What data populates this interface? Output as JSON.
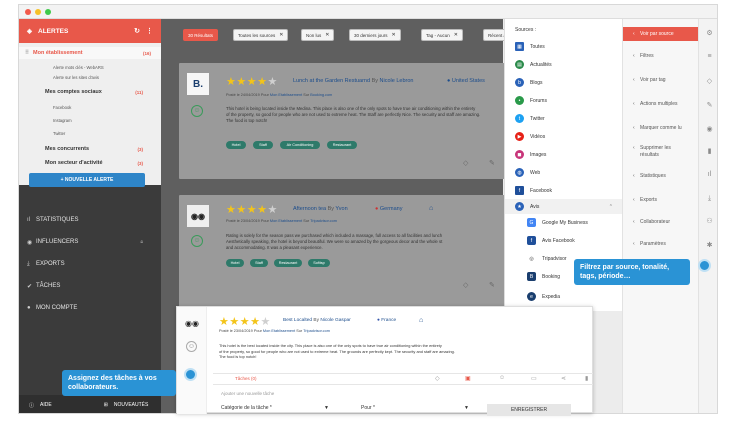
{
  "window": {
    "dots": [
      "#f25a4a",
      "#f6c128",
      "#3fc94a"
    ]
  },
  "sidebar": {
    "alerts_title": "ALERTES",
    "alerts_icon": "tag-icon",
    "panel": {
      "etablissement": "Mon établissement",
      "etablissement_count": "(16)",
      "sub1": "Alerte mots clés - WebARS",
      "sub2": "Alerte sur les sites d'avis",
      "social": "Mes comptes sociaux",
      "social_count": "(11)",
      "facebook": "Facebook",
      "instagram": "Instagram",
      "twitter": "Twitter",
      "concurrents": "Mes concurrents",
      "concurrents_count": "(3)",
      "secteur": "Mon secteur d'activité",
      "secteur_count": "(3)"
    },
    "new_alert": "+ NOUVELLE ALERTE",
    "nav": [
      "STATISTIQUES",
      "INFLUENCERS",
      "EXPORTS",
      "TÂCHES",
      "MON COMPTE"
    ],
    "footer": {
      "help": "AIDE",
      "news": "NOUVEAUTÉS"
    }
  },
  "filters": {
    "results": "30 Résultats",
    "chips": [
      "Toutes les sources",
      "Non lus",
      "30 derniers jours",
      "Tag - Aucun",
      "Récent au +"
    ]
  },
  "cards": [
    {
      "title_place": "Lunch at the Garden Restuarnd",
      "by": "By",
      "author": "Nicole Lebron",
      "country": "United States",
      "posted": "Posté le 24/04/2019 Pour",
      "establishment": "Mon Etablissement",
      "sur": "Sur",
      "site": "Booking.com",
      "rating": 4.5,
      "text1": "This hotel is being located inside the Medina. This place is also one of the only spots to have true air conditioning within the entirety",
      "text2": "of the property, so good for people who are not used to extreme heat. The Staff are perfectly Nice. The security and staff are amazing.",
      "text3": "The food is top notch!",
      "tags": [
        "Hotel",
        "Staff",
        "Air Conditioning",
        "Restaurant"
      ]
    },
    {
      "title_place": "Afternoon tea",
      "by": "By",
      "author": "Yvon",
      "country": "Germany",
      "posted": "Posté le 23/04/2019 Pour",
      "establishment": "Mon Etablissement",
      "sur": "Sur",
      "site": "Tripadvisor.com",
      "rating": 4,
      "text1": "Rating is solely for the season pass we purchased which included a massage, full access to all facilities and lunch",
      "text2": "Aesthetically speaking, the hotel is beyond beautiful. We were so amazed by the gorgeous decor and the whole st",
      "text3": "and accommodating. It was a pleasant experience.",
      "tags": [
        "Hotel",
        "Staff",
        "Restaurant",
        "Sofitsp"
      ]
    }
  ],
  "front_card": {
    "title_place": "Best Localted",
    "by": "By",
    "author": "Nicole Gaspar",
    "country": "France",
    "posted": "Posté le 23/04/2019 Pour",
    "establishment": "Mon Etablissement",
    "sur": "Sur",
    "site": "Tripadvisor.com",
    "rating": 4.5,
    "text1": "This hotel is the best located inside the city. This place is also one of the only spots to have true air conditioning within the entirety",
    "text2": "of the property, so good for people who are not used to extreme heat. The grounds are perfectly kept. The security and staff are amazing.",
    "text3": "The food is top notch!",
    "task_label": "Tâches (0)",
    "new_task": "Ajouter une nouvelle tâche",
    "category": "Catégorie de la tâche *",
    "for": "Pour *",
    "save": "ENREGISTRER"
  },
  "sources": {
    "title": "Sources :",
    "items": [
      {
        "label": "Toutes",
        "icon": "grid-icon",
        "color": "#2a62b8"
      },
      {
        "label": "Actualités",
        "icon": "news-icon",
        "color": "#2a8a4a"
      },
      {
        "label": "Blogs",
        "icon": "blog-icon",
        "color": "#2a62b8"
      },
      {
        "label": "Forums",
        "icon": "forum-icon",
        "color": "#2a9a4a"
      },
      {
        "label": "Twitter",
        "icon": "twitter-icon",
        "color": "#1da1f2"
      },
      {
        "label": "Vidéos",
        "icon": "video-icon",
        "color": "#e62117"
      },
      {
        "label": "Images",
        "icon": "image-icon",
        "color": "#c8357a"
      },
      {
        "label": "Web",
        "icon": "web-icon",
        "color": "#2a62b8"
      },
      {
        "label": "Facebook",
        "icon": "facebook-icon",
        "color": "#1f4f9a"
      },
      {
        "label": "Avis",
        "icon": "review-icon",
        "color": "#2a62b8"
      }
    ],
    "sub": [
      {
        "label": "Google My Business",
        "icon": "google-icon",
        "color": "#4285f4"
      },
      {
        "label": "Avis Facebook",
        "icon": "facebook-icon",
        "color": "#1f4f9a"
      },
      {
        "label": "Tripadvisor",
        "icon": "tripadvisor-icon",
        "color": "#333333"
      },
      {
        "label": "Booking",
        "icon": "booking-icon",
        "color": "#1a3e6e"
      },
      {
        "label": "Expedia",
        "icon": "expedia-icon",
        "color": "#1a3e6e"
      }
    ]
  },
  "right_menu": [
    {
      "label": "Voir par source"
    },
    {
      "label": "Filtres"
    },
    {
      "label": "Voir par tag"
    },
    {
      "label": "Actions multiples"
    },
    {
      "label": "Marquer comme lu"
    },
    {
      "label": "Supprimer les résultats"
    },
    {
      "label": "Statistiques"
    },
    {
      "label": "Exports"
    },
    {
      "label": "Collaborateur"
    },
    {
      "label": "Paramètres"
    }
  ],
  "tooltips": {
    "filters": "Filtrez par source, tonalité, tags, période…",
    "tasks": "Assignez des tâches à vos collaborateurs."
  }
}
